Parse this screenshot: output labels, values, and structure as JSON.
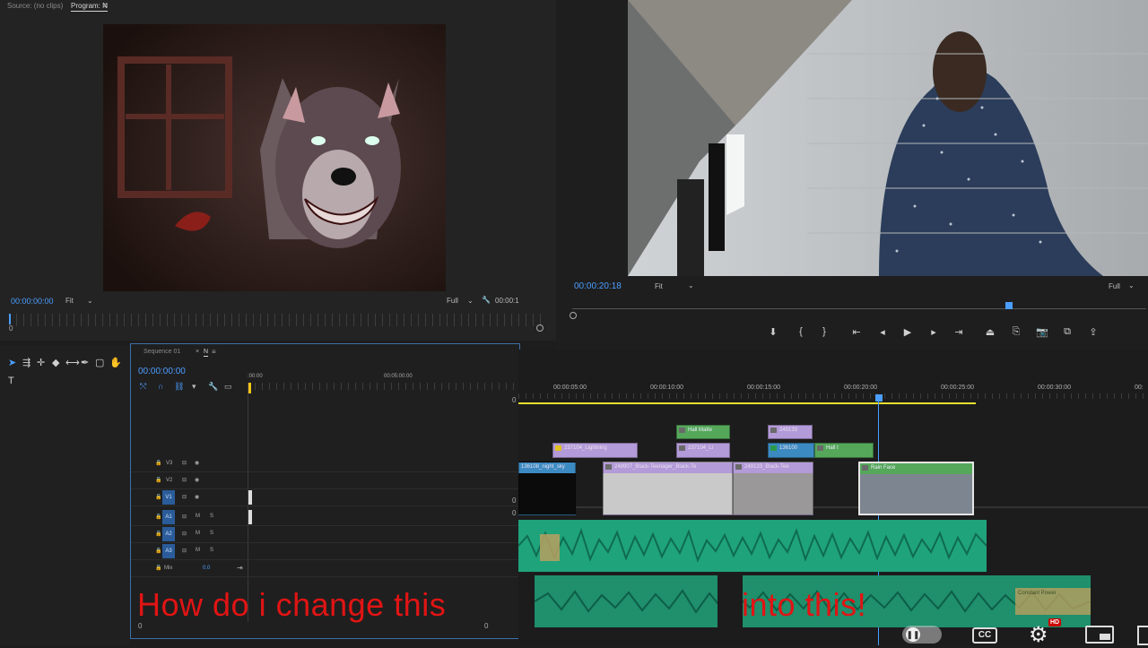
{
  "left_monitor": {
    "tabs": [
      "Source: (no clips)",
      "Program: N"
    ],
    "timecode": "00:00:00:00",
    "fit_select": "Fit",
    "resolution_select": "Full",
    "end_timecode": "00:00:1",
    "ruler_zero": "0"
  },
  "right_monitor": {
    "timecode": "00:00:20:18",
    "fit_select": "Fit",
    "resolution_select": "Full"
  },
  "timeline_left": {
    "sequence_tabs": [
      "Sequence 01",
      "N"
    ],
    "timecode": "00:00:00:00",
    "ruler_labels": [
      ":00:00",
      "00:05:00:00"
    ],
    "tracks": [
      {
        "lock": "🔒",
        "name": "V3",
        "targeted": false,
        "eye": "◉"
      },
      {
        "lock": "🔒",
        "name": "V2",
        "targeted": false,
        "eye": "◉"
      },
      {
        "lock": "🔒",
        "name": "V1",
        "targeted": true,
        "eye": "◉"
      },
      {
        "lock": "🔒",
        "name": "A1",
        "targeted": true,
        "m": "M",
        "s": "S"
      },
      {
        "lock": "🔒",
        "name": "A2",
        "targeted": true,
        "m": "M",
        "s": "S"
      },
      {
        "lock": "🔒",
        "name": "A3",
        "targeted": true,
        "m": "M",
        "s": "S"
      }
    ],
    "mix_label": "Mix",
    "mix_value": "0.0",
    "scroll_start": "0",
    "scroll_end": "0"
  },
  "timeline_right": {
    "ruler_labels": [
      "00:00:05:00",
      "00:00:10:00",
      "00:00:15:00",
      "00:00:20:00",
      "00:00:25:00",
      "00:00:30:00",
      "00:"
    ],
    "clips": {
      "hall_matte": "Hall Matte",
      "c249133_top": "249133",
      "lightning": "237104_Lightning",
      "c237104_li": "237104_Li",
      "c136100": "136100",
      "hall_i": "Hall I",
      "night_sky": "136108_night_sky",
      "black_teen": "248907_Black-Teenager_Black-Te",
      "c249133_black": "249133_Black-Tee",
      "rain_face": "Rain Face",
      "audio_label": "Constant Power"
    },
    "zero_labels": [
      "0",
      "0",
      "0"
    ]
  },
  "overlay": {
    "left_text": "How do i change this",
    "right_text": "into this!"
  },
  "player_controls": {
    "cc_label": "CC",
    "hd_badge": "HD"
  }
}
